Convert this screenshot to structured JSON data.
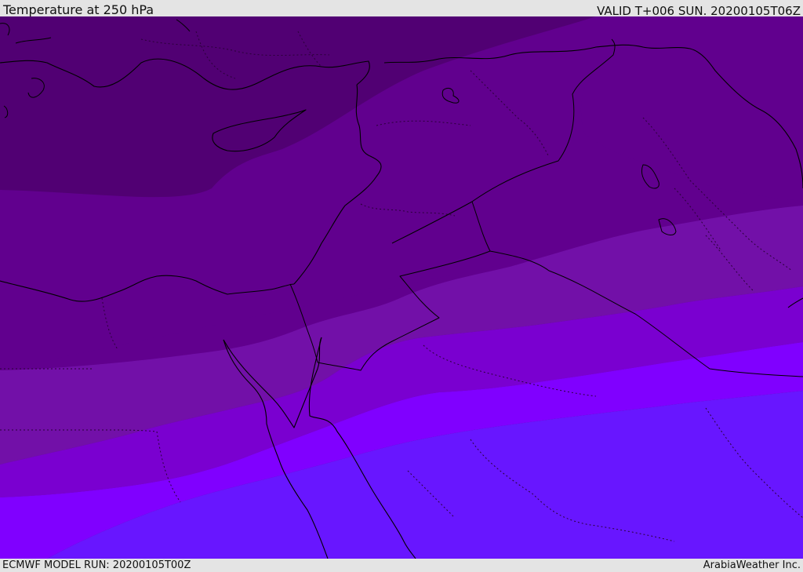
{
  "header": {
    "title": "Temperature at 250 hPa",
    "valid_time": "VALID T+006 SUN. 20200105T06Z"
  },
  "footer": {
    "model_run": "ECMWF MODEL RUN: 20200105T00Z",
    "credit": "ArabiaWeather Inc."
  },
  "map": {
    "variable": "temperature",
    "level": "250 hPa",
    "colors": {
      "band_1_coldest": "#510073",
      "band_2": "#61008e",
      "band_3": "#7210a8",
      "band_4": "#7a00d0",
      "band_5": "#8000ff",
      "band_6_warmest": "#6816ff",
      "coastline": "#000000",
      "border_dotted": "#2a0038"
    }
  }
}
